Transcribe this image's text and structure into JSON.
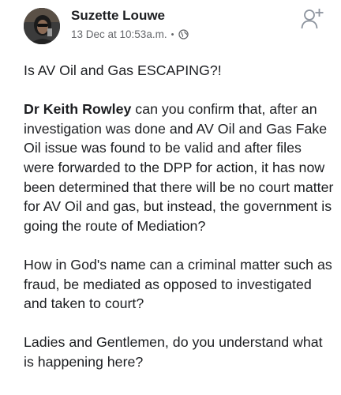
{
  "post": {
    "author": "Suzette Louwe",
    "timestamp": "13 Dec at 10:53a.m.",
    "separator": "•",
    "privacy_icon": "globe-icon",
    "action_icon": "add-friend-icon",
    "paragraphs": {
      "p1": "Is AV Oil and Gas ESCAPING?!",
      "p2_bold": "Dr Keith Rowley",
      "p2_rest": " can you confirm that, after an investigation was done and AV Oil and Gas Fake Oil issue was found to be valid and after files were forwarded to the DPP for action, it has now been determined that there will be no court matter for AV Oil and gas, but instead, the government is going the route of Mediation?",
      "p3": "How in God's name can a criminal matter such as fraud, be mediated as opposed to investigated and taken to court?",
      "p4": "Ladies and Gentlemen, do you understand what is happening here?"
    }
  },
  "colors": {
    "text": "#1c1e21",
    "meta": "#65676b",
    "icon": "#8d949e"
  }
}
